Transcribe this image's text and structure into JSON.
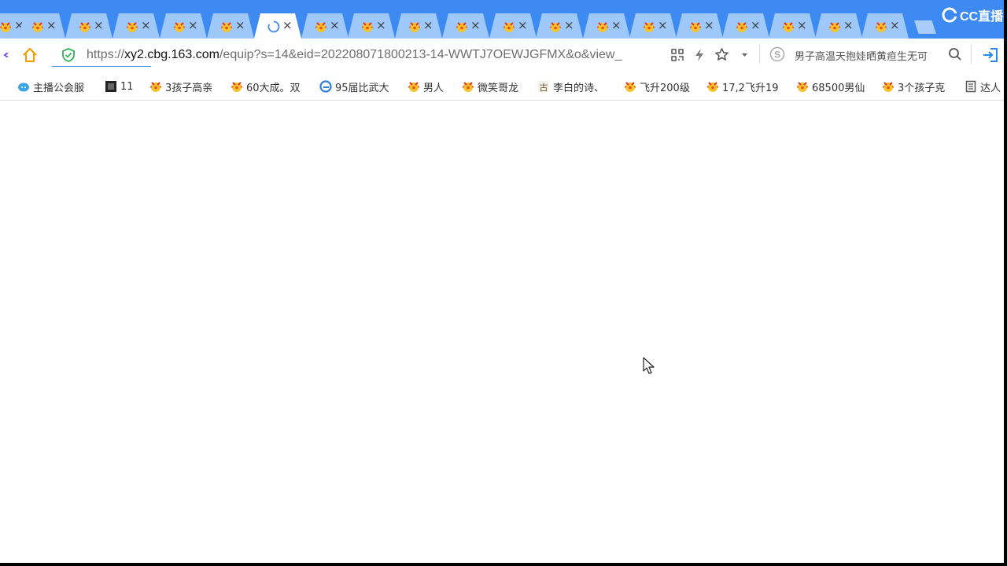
{
  "tabs": {
    "close_glyph": "×",
    "active_index": 6,
    "count": 20
  },
  "brand": {
    "label": "CC直播"
  },
  "address": {
    "url_scheme": "https://",
    "url_host": "xy2.cbg.163.com",
    "url_path": "/equip?s=14&eid=202208071800213-14-WWTJ7OEWJGFMX&o&view_",
    "search_text": "男子高温天抱娃晒黄疸生无可"
  },
  "bookmarks": [
    {
      "label": "主播公会服",
      "icon": "cloud-icon"
    },
    {
      "label": "11",
      "icon": "dark-page-icon"
    },
    {
      "label": "3孩子高亲",
      "icon": "chick-icon"
    },
    {
      "label": "60大成。双",
      "icon": "chick-icon"
    },
    {
      "label": "95届比武大",
      "icon": "browser-icon"
    },
    {
      "label": "男人",
      "icon": "chick-icon"
    },
    {
      "label": "微笑哥龙",
      "icon": "chick-icon"
    },
    {
      "label": "李白的诗、",
      "icon": "poem-icon"
    },
    {
      "label": "飞升200级",
      "icon": "chick-icon"
    },
    {
      "label": "17,2飞升19",
      "icon": "chick-icon"
    },
    {
      "label": "68500男仙",
      "icon": "chick-icon"
    },
    {
      "label": "3个孩子克",
      "icon": "chick-icon"
    },
    {
      "label": "达人",
      "icon": "document-icon"
    }
  ],
  "colors": {
    "tabstrip": "#3d8bf2",
    "inactive_tab": "#9fc8fa",
    "active_tab": "#ffffff",
    "link_accent": "#4a90e2"
  }
}
